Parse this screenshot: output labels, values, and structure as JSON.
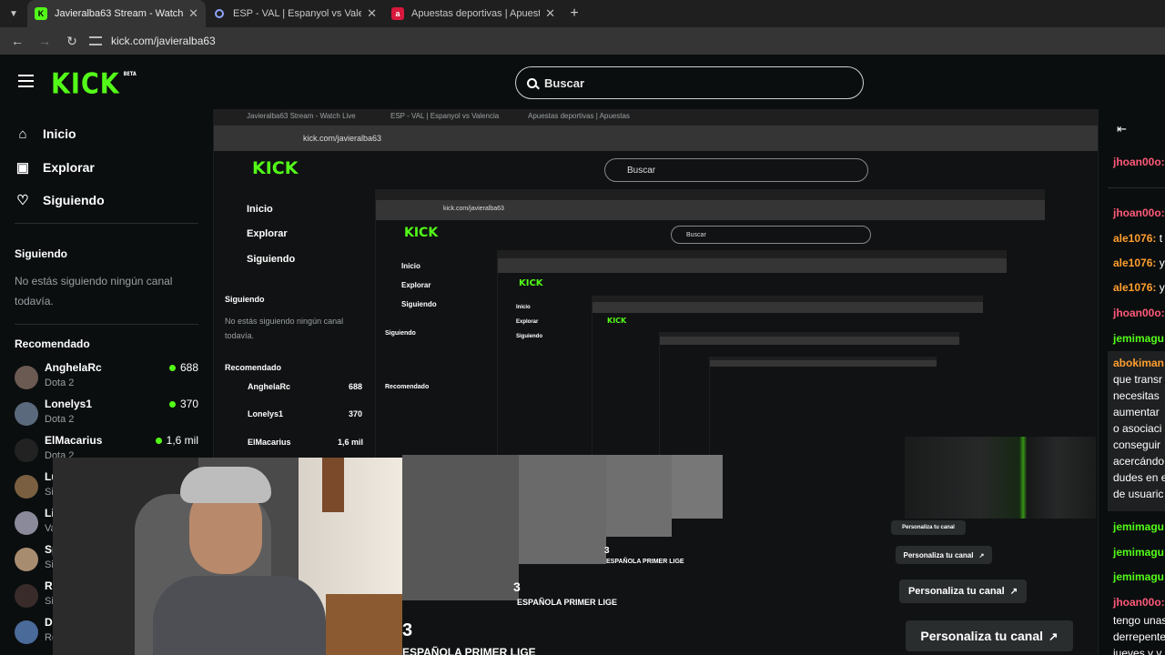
{
  "browser": {
    "tabs": [
      {
        "title": "Javieralba63 Stream - Watch Live",
        "favicon": "K",
        "active": true
      },
      {
        "title": "ESP - VAL | Espanyol vs Valencia",
        "favicon": "",
        "active": false
      },
      {
        "title": "Apuestas deportivas | Apuestas",
        "favicon": "a",
        "active": false
      }
    ],
    "url": "kick.com/javieralba63"
  },
  "header": {
    "logo": "KICK",
    "logo_badge": "BETA",
    "search_placeholder": "Buscar"
  },
  "sidebar": {
    "nav": [
      {
        "label": "Inicio",
        "icon": "home-icon"
      },
      {
        "label": "Explorar",
        "icon": "explore-icon"
      },
      {
        "label": "Siguiendo",
        "icon": "heart-icon"
      }
    ],
    "following_title": "Siguiendo",
    "following_empty": "No estás siguiendo ningún canal todavía.",
    "recommended_title": "Recomendado",
    "recommended": [
      {
        "name": "AnghelaRc",
        "game": "Dota 2",
        "viewers": "688"
      },
      {
        "name": "Lonelys1",
        "game": "Dota 2",
        "viewers": "370"
      },
      {
        "name": "ElMacarius",
        "game": "Dota 2",
        "viewers": "1,6 mil"
      },
      {
        "name": "Lu",
        "game": "Si",
        "viewers": ""
      },
      {
        "name": "Li",
        "game": "Va",
        "viewers": ""
      },
      {
        "name": "Sp",
        "game": "Si",
        "viewers": ""
      },
      {
        "name": "Re",
        "game": "Si",
        "viewers": ""
      },
      {
        "name": "Di",
        "game": "Ro",
        "viewers": ""
      }
    ]
  },
  "main": {
    "personaliza": "Personaliza tu canal",
    "stream_number": "3",
    "stream_title_fragment": "ESPAÑOLA PRIMER LIGE"
  },
  "chat": {
    "messages": [
      {
        "user": "jhoan00o:",
        "color": "#ff5a7a",
        "text": ""
      },
      {
        "user": "jhoan00o:",
        "color": "#ff5a7a",
        "text": ""
      },
      {
        "user": "ale1076:",
        "color": "#ff9f2e",
        "text": " t"
      },
      {
        "user": "ale1076:",
        "color": "#ff9f2e",
        "text": " y"
      },
      {
        "user": "ale1076:",
        "color": "#ff9f2e",
        "text": " y"
      },
      {
        "user": "jhoan00o:",
        "color": "#ff5a7a",
        "text": ""
      },
      {
        "user": "jemimagu",
        "color": "#53fc18",
        "text": ""
      }
    ],
    "highlight_user": "abokiman",
    "highlight_lines": [
      "que transr",
      "necesitas",
      "aumentar",
      "o asociaci",
      "conseguir",
      "acercándo",
      "dudes en e",
      "de usuaric"
    ],
    "after": [
      {
        "user": "jemimagu",
        "color": "#53fc18"
      },
      {
        "user": "jemimagu",
        "color": "#53fc18"
      },
      {
        "user": "jemimagu",
        "color": "#53fc18"
      },
      {
        "user": "jhoan00o:",
        "color": "#ff5a7a"
      }
    ],
    "tail_lines": [
      "tengo unas",
      "derrepente",
      "jueves y v"
    ]
  },
  "colors": {
    "brand": "#53fc18",
    "bg": "#0b0e0f"
  }
}
